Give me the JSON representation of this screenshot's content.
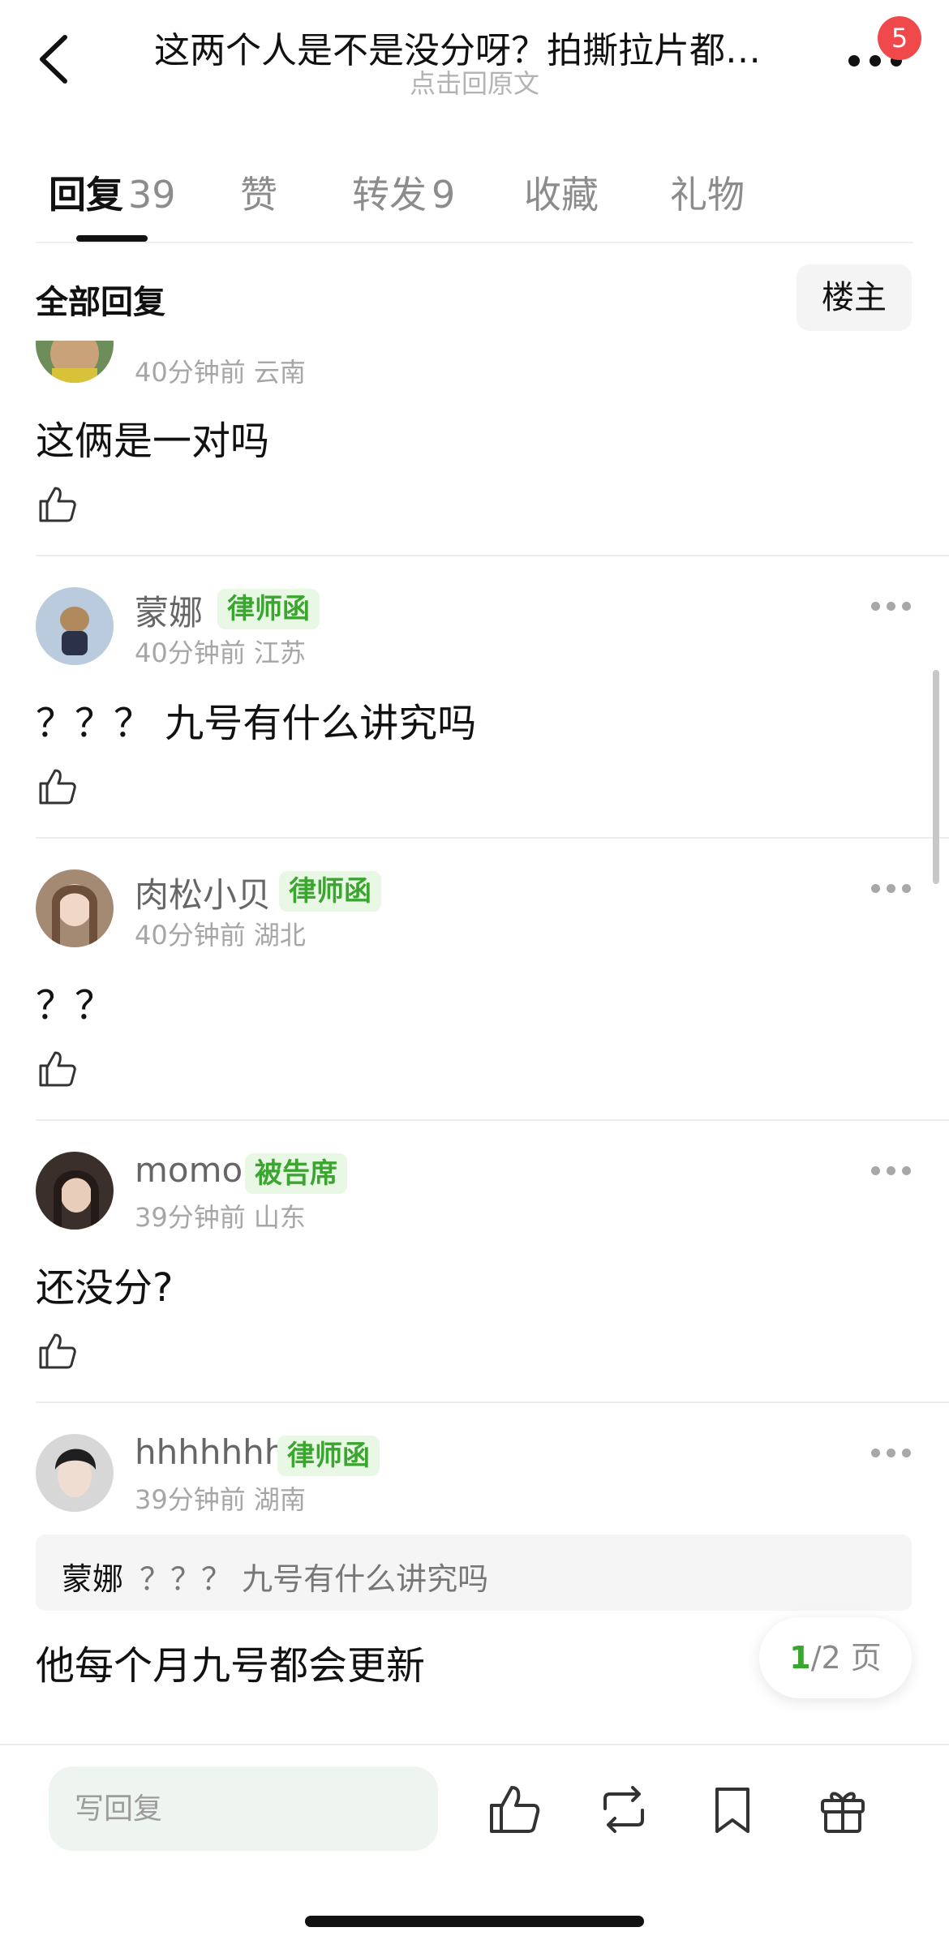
{
  "header": {
    "title": "这两个人是不是没分呀？拍撕拉片都…",
    "subtitle": "点击回原文",
    "notification_count": "5"
  },
  "tabs": [
    {
      "label": "回复",
      "count": "39"
    },
    {
      "label": "赞",
      "count": ""
    },
    {
      "label": "转发",
      "count": "9"
    },
    {
      "label": "收藏",
      "count": ""
    },
    {
      "label": "礼物",
      "count": ""
    }
  ],
  "filter": {
    "label": "全部回复",
    "owner_button": "楼主"
  },
  "comments": [
    {
      "name": "",
      "tag": "",
      "time": "40分钟前",
      "location": "云南",
      "text": "这俩是一对吗"
    },
    {
      "name": "蒙娜",
      "tag": "律师函",
      "time": "40分钟前",
      "location": "江苏",
      "text": "？？？ 九号有什么讲究吗"
    },
    {
      "name": "肉松小贝",
      "tag": "律师函",
      "time": "40分钟前",
      "location": "湖北",
      "text": "？？"
    },
    {
      "name": "momo",
      "tag": "被告席",
      "time": "39分钟前",
      "location": "山东",
      "text": "还没分?"
    },
    {
      "name": "hhhhhhh",
      "tag": "律师函",
      "time": "39分钟前",
      "location": "湖南",
      "text": "他每个月九号都会更新",
      "quote": {
        "name": "蒙娜",
        "text": "？？？ 九号有什么讲究吗"
      }
    }
  ],
  "pager": {
    "current": "1",
    "total": "/2 页"
  },
  "bottom": {
    "reply_placeholder": "写回复"
  },
  "colors": {
    "accent_green": "#3aa52f",
    "tag_bg": "#e9f7e5",
    "badge_red": "#f0494c"
  },
  "icons": [
    "back-icon",
    "more-icon",
    "thumbs-up-icon",
    "repost-icon",
    "bookmark-icon",
    "gift-icon"
  ]
}
